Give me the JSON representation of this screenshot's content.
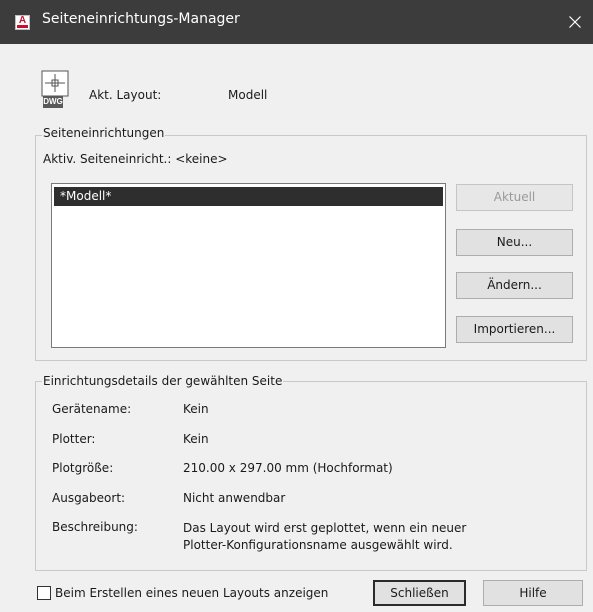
{
  "window": {
    "title": "Seiteneinrichtungs-Manager",
    "app_icon_letter": "A",
    "close_icon": "close-icon"
  },
  "current_layout": {
    "icon": "dwg-file-icon",
    "icon_text": "DWG",
    "label": "Akt. Layout:",
    "value": "Modell"
  },
  "page_setups": {
    "group_title": "Seiteneinrichtungen",
    "active_label": "Aktiv. Seiteneinricht.: <keine>",
    "list": [
      {
        "label": "*Modell*",
        "selected": true
      }
    ],
    "buttons": {
      "current": "Aktuell",
      "new": "Neu...",
      "modify": "Ändern...",
      "import": "Importieren..."
    }
  },
  "details": {
    "group_title": "Einrichtungsdetails der gewählten Seite",
    "rows": [
      {
        "label": "Gerätename:",
        "value": "Kein"
      },
      {
        "label": "Plotter:",
        "value": "Kein"
      },
      {
        "label": "Plotgröße:",
        "value": "210.00 x 297.00 mm (Hochformat)"
      },
      {
        "label": "Ausgabeort:",
        "value": "Nicht anwendbar"
      },
      {
        "label": "Beschreibung:",
        "value_line1": "Das Layout wird erst geplottet, wenn ein neuer",
        "value_line2": "Plotter-Konfigurationsname ausgewählt wird."
      }
    ]
  },
  "footer": {
    "checkbox_label": "Beim Erstellen eines neuen Layouts anzeigen",
    "checkbox_checked": false,
    "close_button": "Schließen",
    "help_button": "Hilfe"
  },
  "colors": {
    "titlebar": "#3c3c3c",
    "dialog_bg": "#f0f0f0",
    "selection": "#2e2e2e",
    "app_icon_accent": "#c8102e"
  }
}
